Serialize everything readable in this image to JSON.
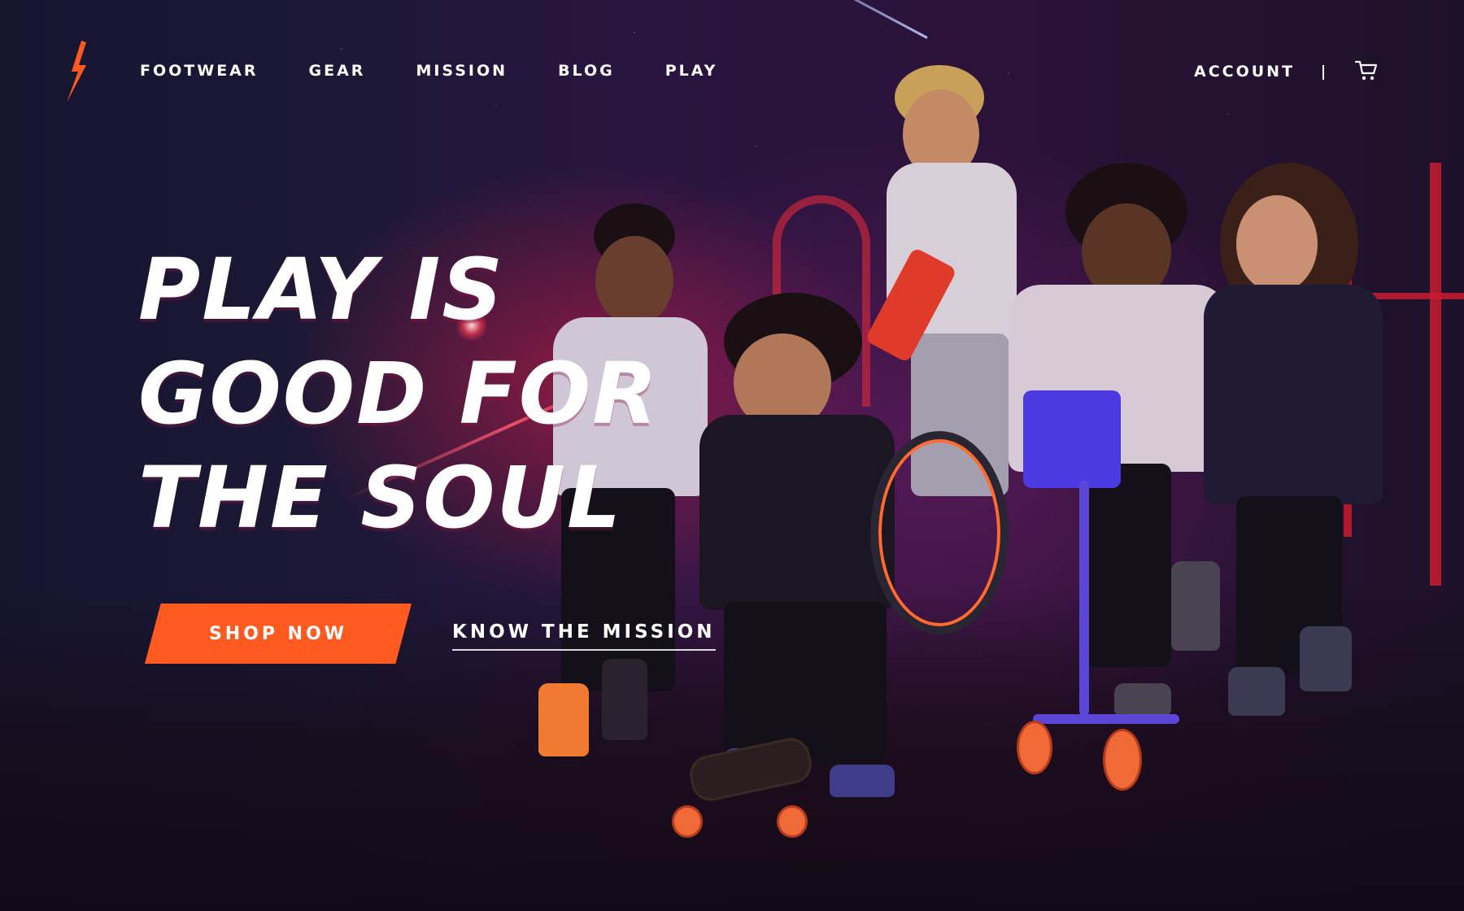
{
  "nav": {
    "items": [
      {
        "label": "FOOTWEAR"
      },
      {
        "label": "GEAR"
      },
      {
        "label": "MISSION"
      },
      {
        "label": "BLOG"
      },
      {
        "label": "PLAY"
      }
    ],
    "account_label": "ACCOUNT",
    "logo_icon": "lightning-bolt-icon",
    "cart_icon": "shopping-cart-icon"
  },
  "hero": {
    "headline_lines": [
      "PLAY IS",
      "GOOD FOR",
      "THE SOUL"
    ],
    "primary_cta": "SHOP NOW",
    "secondary_cta": "KNOW THE MISSION"
  },
  "colors": {
    "accent": "#ff5a1f",
    "background": "#15142c",
    "text": "#ffffff"
  }
}
